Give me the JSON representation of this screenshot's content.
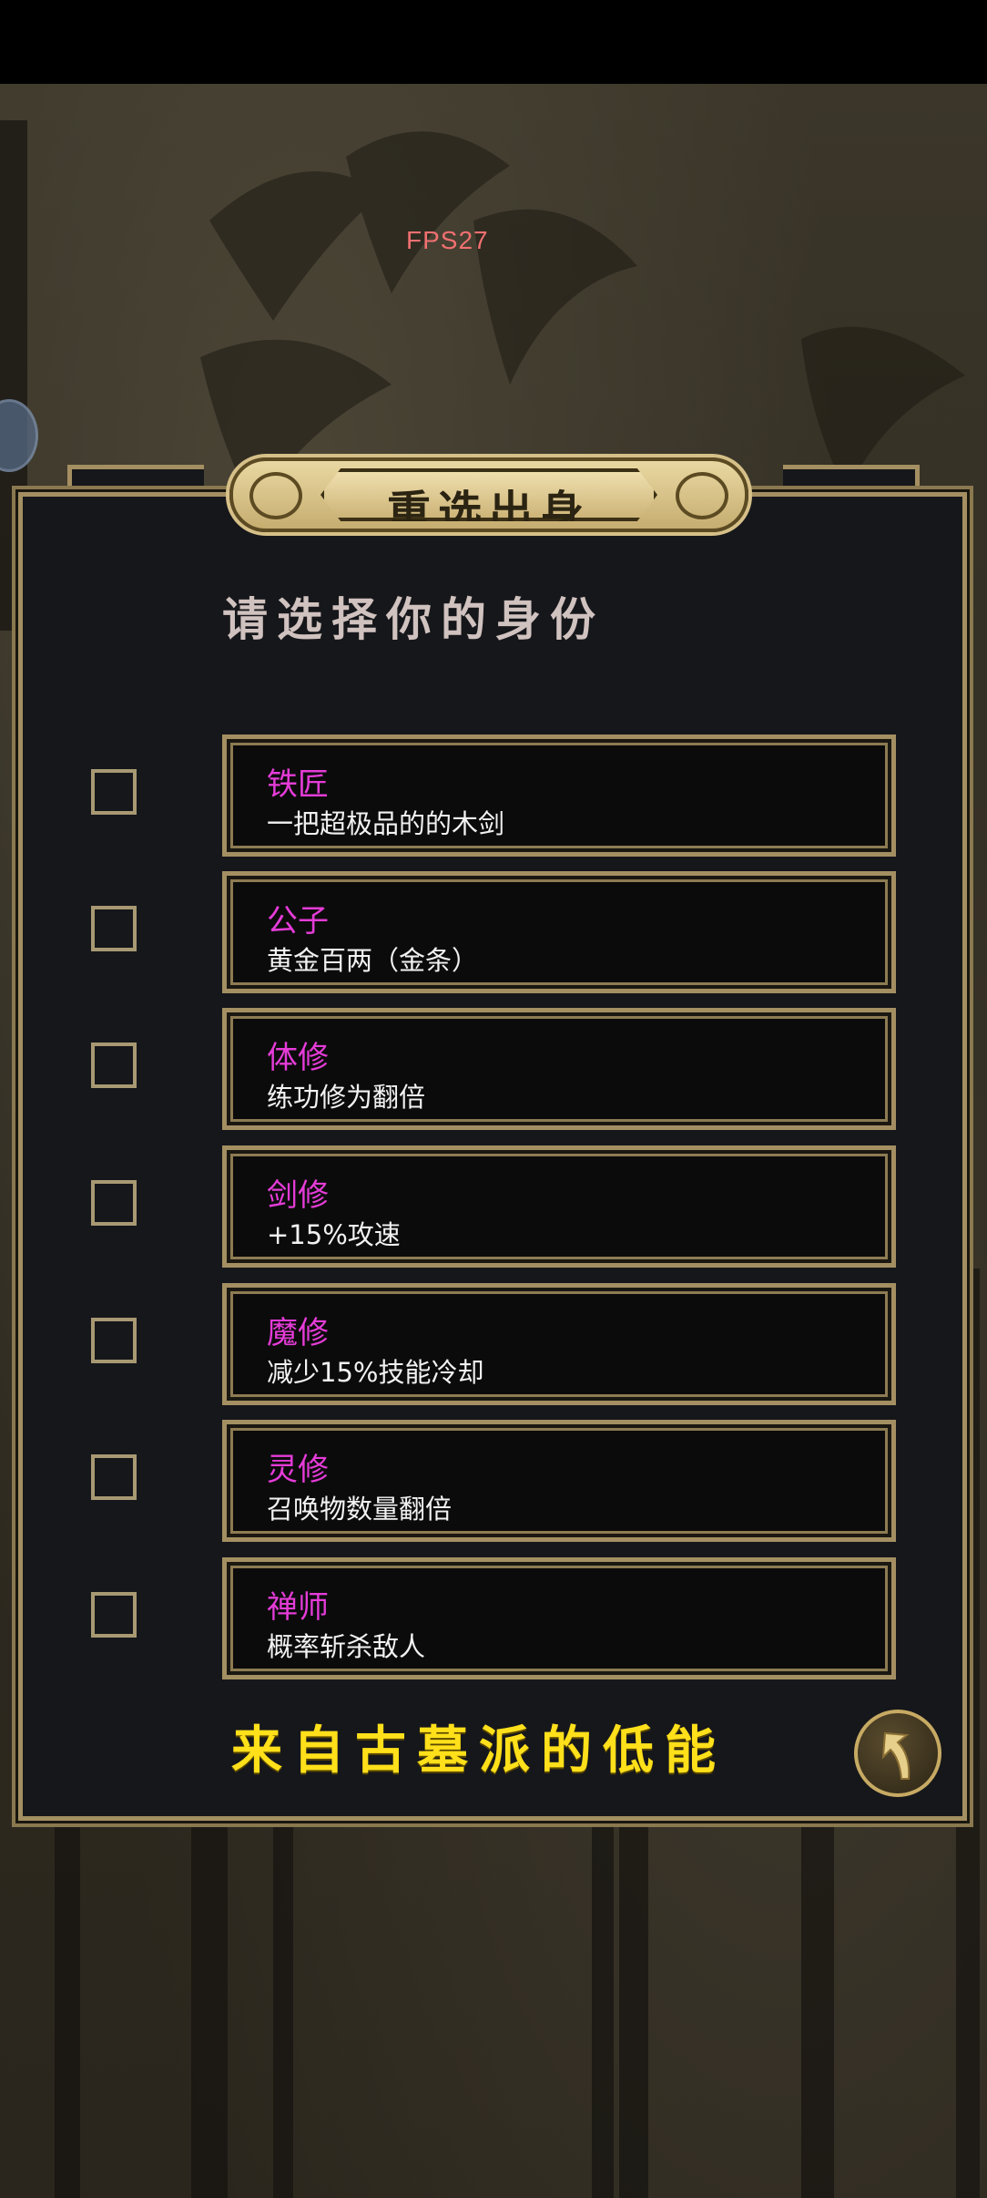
{
  "hud": {
    "fps": "FPS27"
  },
  "dialog": {
    "title": "重选出身",
    "subtitle": "请选择你的身份",
    "options": [
      {
        "name": "铁匠",
        "desc": "一把超极品的的木剑",
        "checked": false
      },
      {
        "name": "公子",
        "desc": "黄金百两（金条）",
        "checked": false
      },
      {
        "name": "体修",
        "desc": "练功修为翻倍",
        "checked": false
      },
      {
        "name": "剑修",
        "desc": "+15%攻速",
        "checked": false
      },
      {
        "name": "魔修",
        "desc": "减少15%技能冷却",
        "checked": false
      },
      {
        "name": "灵修",
        "desc": "召唤物数量翻倍",
        "checked": false
      },
      {
        "name": "禅师",
        "desc": "概率斩杀敌人",
        "checked": false
      }
    ],
    "footer_text": "来自古墓派的低能",
    "back_icon": "return-arrow-icon"
  },
  "colors": {
    "option_name": "#e53cd8",
    "footer_text": "#ffe01a",
    "frame_gold": "#a48f62",
    "fps_text": "#f07070"
  }
}
